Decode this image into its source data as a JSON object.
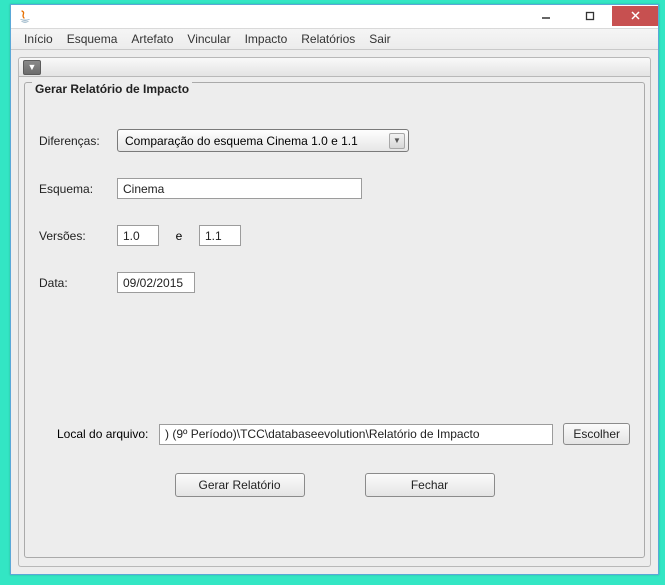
{
  "titlebar": {
    "min_tip": "Minimize",
    "max_tip": "Maximize",
    "close_tip": "Close"
  },
  "menu": {
    "items": [
      "Início",
      "Esquema",
      "Artefato",
      "Vincular",
      "Impacto",
      "Relatórios",
      "Sair"
    ]
  },
  "panel": {
    "group_title": "Gerar Relatório de Impacto",
    "labels": {
      "diferencas": "Diferenças:",
      "esquema": "Esquema:",
      "versoes": "Versões:",
      "e": "e",
      "data": "Data:",
      "local": "Local do arquivo:"
    },
    "values": {
      "diferencas_selected": "Comparação do esquema Cinema 1.0 e 1.1",
      "esquema": "Cinema",
      "versao_a": "1.0",
      "versao_b": "1.1",
      "data": "09/02/2015",
      "local": ") (9º Período)\\TCC\\databaseevolution\\Relatório de Impacto"
    },
    "buttons": {
      "escolher": "Escolher",
      "gerar": "Gerar Relatório",
      "fechar": "Fechar"
    }
  }
}
